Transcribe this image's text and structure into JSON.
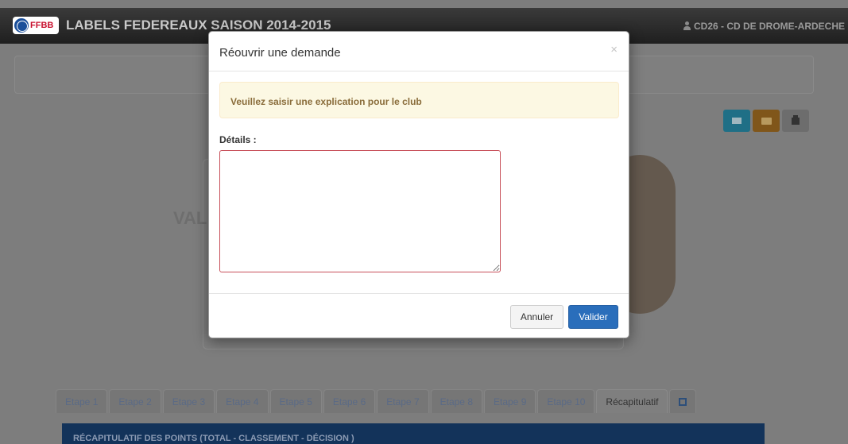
{
  "navbar": {
    "logo_text": "FFBB",
    "title": "LABELS FEDEREAUX SAISON 2014-2015",
    "user": "CD26 - CD DE DROME-ARDECHE"
  },
  "background": {
    "art_text": "VAL"
  },
  "icons": {
    "mail": "envelope-icon",
    "folder": "folder-icon",
    "print": "print-icon",
    "calendar": "calendar-icon"
  },
  "tabs": [
    {
      "label": "Etape 1"
    },
    {
      "label": "Etape 2"
    },
    {
      "label": "Etape 3"
    },
    {
      "label": "Etape 4"
    },
    {
      "label": "Etape 5"
    },
    {
      "label": "Etape 6"
    },
    {
      "label": "Etape 7"
    },
    {
      "label": "Etape 8"
    },
    {
      "label": "Etape 9"
    },
    {
      "label": "Etape 10"
    },
    {
      "label": "Récapitulatif"
    }
  ],
  "section": {
    "title": "RÉCAPITULATIF DES POINTS (TOTAL - CLASSEMENT - DÉCISION )"
  },
  "modal": {
    "title": "Réouvrir une demande",
    "close": "×",
    "alert": "Veuillez saisir une explication pour le club",
    "details_label": "Détails :",
    "details_value": "",
    "cancel_label": "Annuler",
    "ok_label": "Valider"
  },
  "colors": {
    "primary": "#2a6ebb",
    "alert_bg": "#fcf8e3",
    "alert_text": "#8a6d3b",
    "invalid_border": "#c8505a"
  }
}
